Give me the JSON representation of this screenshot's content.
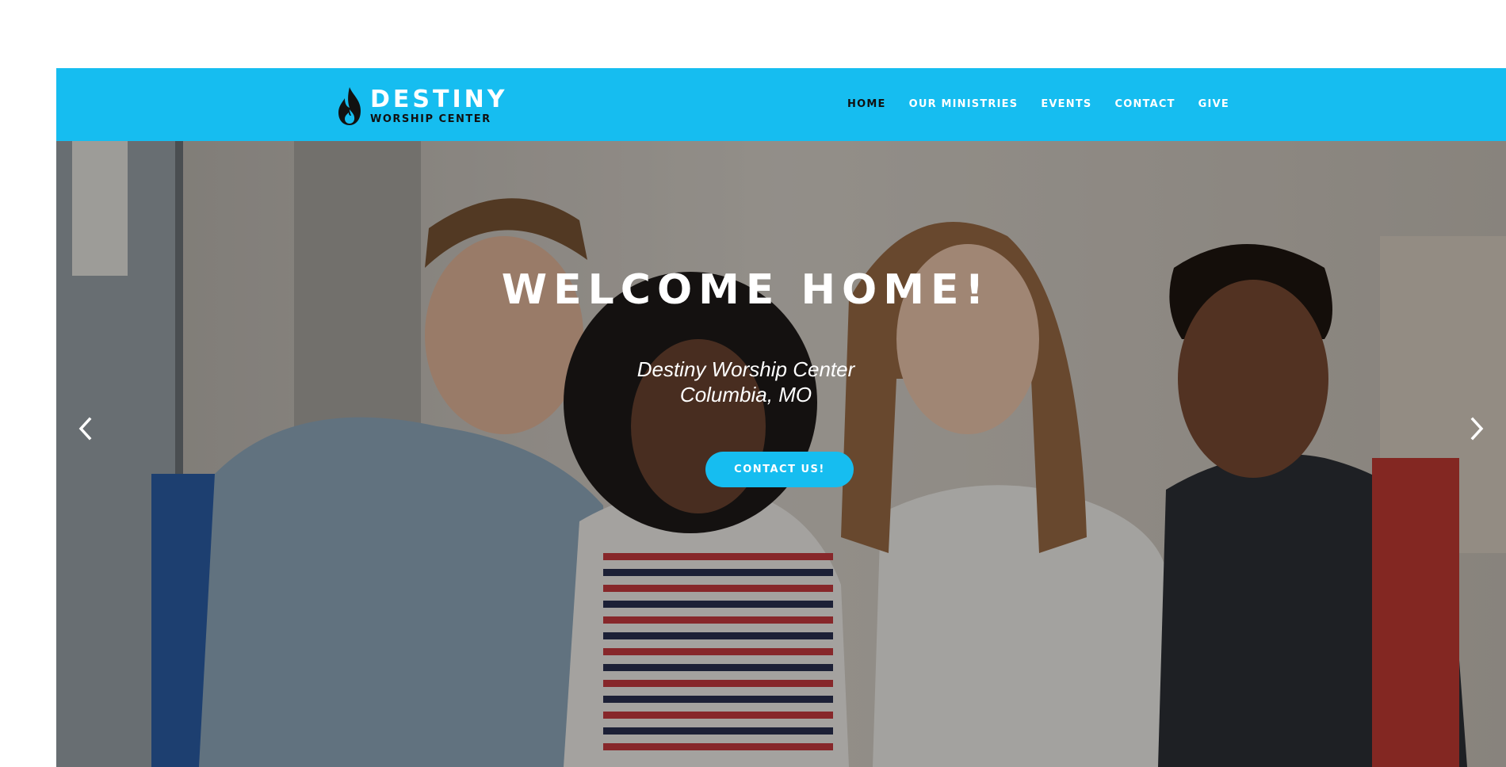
{
  "brand": {
    "title": "DESTINY",
    "subtitle": "WORSHIP CENTER",
    "icon": "flame-icon",
    "color": "#16bdf0"
  },
  "nav": {
    "items": [
      {
        "label": "HOME",
        "active": true
      },
      {
        "label": "OUR MINISTRIES",
        "active": false
      },
      {
        "label": "EVENTS",
        "active": false
      },
      {
        "label": "CONTACT",
        "active": false
      },
      {
        "label": "GIVE",
        "active": false
      }
    ]
  },
  "hero": {
    "title": "WELCOME HOME!",
    "subtitle_line1": "Destiny Worship Center",
    "subtitle_line2": "Columbia, MO",
    "cta_label": "CONTACT US!",
    "prev_icon": "chevron-left-icon",
    "next_icon": "chevron-right-icon"
  }
}
